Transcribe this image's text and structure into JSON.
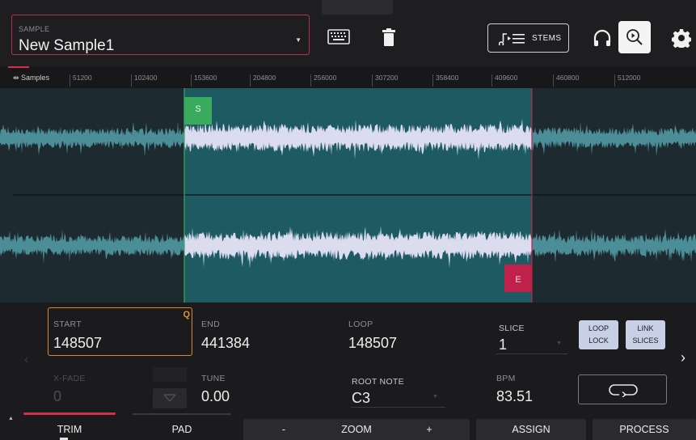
{
  "header": {
    "sample_caption": "SAMPLE",
    "sample_name": "New Sample1",
    "stems_label": "STEMS"
  },
  "ruler": {
    "unit_label": "Samples",
    "ticks": [
      "51200",
      "102400",
      "153600",
      "204800",
      "256000",
      "307200",
      "358400",
      "409600",
      "460800",
      "512000"
    ]
  },
  "waveform": {
    "start_marker_label": "S",
    "end_marker_label": "E",
    "colors": {
      "region_background": "#1e5a62",
      "outside_background": "#1d2a2f",
      "wave_selected": "#dcdcf0",
      "wave_outside": "#4c8e98",
      "start_line": "#3aab5e",
      "end_line": "#c0214a"
    }
  },
  "params": {
    "start": {
      "caption": "START",
      "value": "148507",
      "quantize_badge": "Q"
    },
    "end": {
      "caption": "END",
      "value": "441384"
    },
    "loop": {
      "caption": "LOOP",
      "value": "148507"
    },
    "slice": {
      "caption": "SLICE",
      "value": "1"
    },
    "loop_lock": {
      "line1": "LOOP",
      "line2": "LOCK"
    },
    "link_slices": {
      "line1": "LINK",
      "line2": "SLICES"
    },
    "xfade": {
      "caption": "X-FADE",
      "value": "0"
    },
    "tune": {
      "caption": "TUNE",
      "value": "0.00"
    },
    "root_note": {
      "caption": "ROOT NOTE",
      "value": "C3"
    },
    "bpm": {
      "caption": "BPM",
      "value": "83.51"
    }
  },
  "bottom_tabs": {
    "trim": "TRIM",
    "pad": "PAD",
    "zoom_minus": "-",
    "zoom": "ZOOM",
    "zoom_plus": "+",
    "assign": "ASSIGN",
    "process": "PROCESS"
  },
  "colors": {
    "accent_red": "#d0304a",
    "accent_orange": "#d98a2b",
    "toggle_blue": "#c8d0e6"
  }
}
